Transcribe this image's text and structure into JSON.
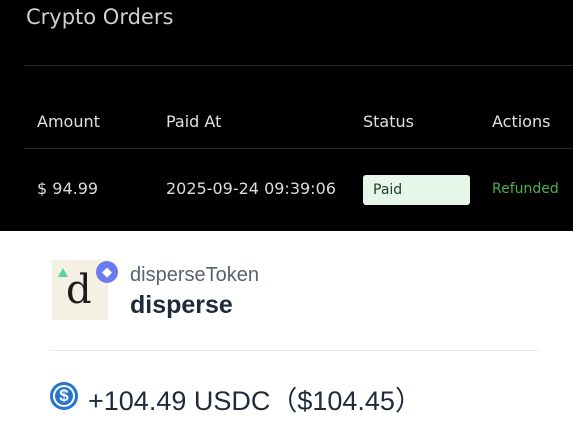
{
  "orders": {
    "title": "Crypto Orders",
    "columns": [
      "Amount",
      "Paid At",
      "Status",
      "Actions"
    ],
    "row": {
      "amount": "$ 94.99",
      "paid_at": "2025-09-24 09:39:06",
      "status": "Paid",
      "action": "Refunded"
    }
  },
  "token": {
    "name_sub": "disperseToken",
    "name_main": "disperse",
    "logo_letter": "d",
    "chain_icon": "ethereum-icon"
  },
  "transfer": {
    "icon": "usdc-icon",
    "icon_glyph": "$",
    "amount": "+104.49 USDC（$104.45）"
  },
  "colors": {
    "status_bg": "#e6f7ea",
    "refunded": "#4caf50",
    "usdc": "#2775ca",
    "eth": "#6c7cf0"
  }
}
